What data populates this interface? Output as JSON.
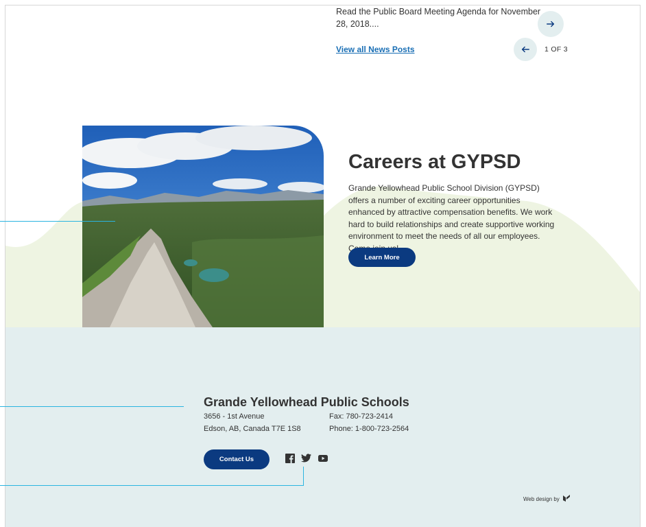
{
  "news": {
    "excerpt": "Read the Public Board Meeting Agenda for November 28, 2018....",
    "view_all_label": "View all News Posts",
    "pagination": "1 OF 3"
  },
  "careers": {
    "title": "Careers at GYPSD",
    "description": "Grande Yellowhead Public School Division (GYPSD) offers a number of exciting career opportunities enhanced by attractive compensation benefits. We work hard to build relationships and create supportive working environment to meet the needs of all our employees. Come join us!",
    "button_label": "Learn More"
  },
  "footer": {
    "title": "Grande Yellowhead Public Schools",
    "address_line1": "3656 - 1st Avenue",
    "address_line2": "Edson, AB, Canada T7E 1S8",
    "fax": "Fax: 780-723-2414",
    "phone": "Phone: 1-800-723-2564",
    "contact_label": "Contact Us",
    "credit": "Web design by"
  },
  "icons": {
    "next": "arrow-right-icon",
    "prev": "arrow-left-icon",
    "facebook": "facebook-icon",
    "twitter": "twitter-icon",
    "youtube": "youtube-icon",
    "credit_logo": "agency-logo-icon"
  },
  "colors": {
    "primary_button": "#0b3a80",
    "link": "#1a6fb5",
    "footer_bg": "#e3eeef",
    "hills": "#eef4e2",
    "annotation": "#2ab4e0"
  }
}
